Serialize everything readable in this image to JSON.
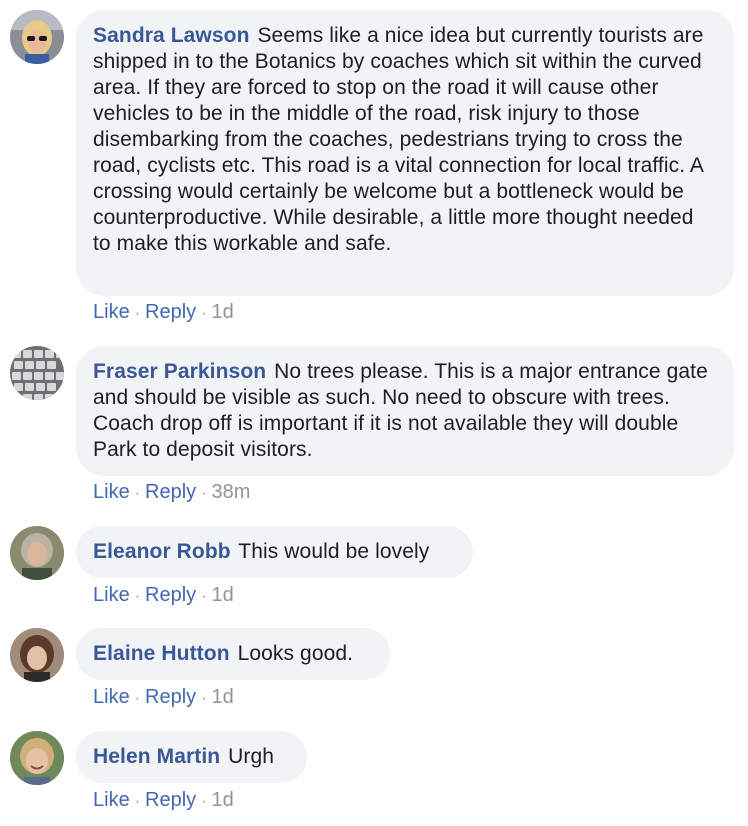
{
  "comments": [
    {
      "avatar": "avatar-woman-blonde-sunglasses",
      "author": "Sandra Lawson",
      "text": "Seems like a nice idea but currently tourists are shipped in to the Botanics by coaches which sit within the curved area. If they are forced to stop on the road it will cause other vehicles to be in the middle of the road, risk injury to those disembarking from the coaches, pedestrians trying to cross the road, cyclists etc. This road is a vital connection for local traffic. A crossing would certainly be welcome but a bottleneck would be counterproductive. While desirable, a little more thought needed to make this workable and safe.",
      "like_label": "Like",
      "reply_label": "Reply",
      "separator": "·",
      "time": "1d"
    },
    {
      "avatar": "avatar-keyboard",
      "author": "Fraser Parkinson",
      "text": "No trees please. This is a major entrance gate and should be visible as such. No need to obscure with trees. Coach drop off is important if it is not available they will double Park to deposit visitors.",
      "like_label": "Like",
      "reply_label": "Reply",
      "separator": "·",
      "time": "38m"
    },
    {
      "avatar": "avatar-woman-grey-hair",
      "author": "Eleanor Robb",
      "text": "This would be lovely",
      "like_label": "Like",
      "reply_label": "Reply",
      "separator": "·",
      "time": "1d"
    },
    {
      "avatar": "avatar-woman-bob-hair",
      "author": "Elaine Hutton",
      "text": "Looks good.",
      "like_label": "Like",
      "reply_label": "Reply",
      "separator": "·",
      "time": "1d"
    },
    {
      "avatar": "avatar-woman-smiling-blonde",
      "author": "Helen Martin",
      "text": "Urgh",
      "like_label": "Like",
      "reply_label": "Reply",
      "separator": "·",
      "time": "1d"
    }
  ],
  "colors": {
    "author": "#385898",
    "link": "#4267b2",
    "meta": "#90949c",
    "bubble": "#f2f3f5",
    "text": "#1c1e21"
  }
}
